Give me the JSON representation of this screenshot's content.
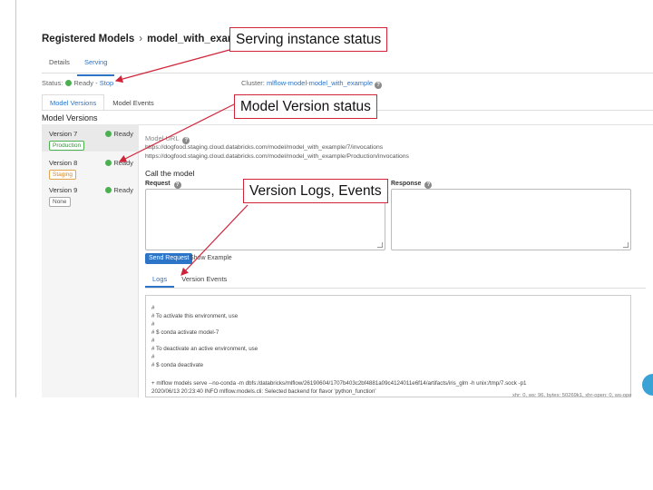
{
  "breadcrumb": {
    "parent": "Registered Models",
    "separator": "›",
    "model": "model_with_example",
    "caret": "▾"
  },
  "top_tabs": [
    {
      "label": "Details"
    },
    {
      "label": "Serving",
      "active": true
    }
  ],
  "status": {
    "label": "Status:",
    "state": "Ready",
    "separator": "-",
    "action": "Stop"
  },
  "cluster": {
    "label": "Cluster:",
    "name": "mlflow-model-model_with_example"
  },
  "model_tabs": [
    {
      "label": "Model Versions",
      "active": true
    },
    {
      "label": "Model Events"
    }
  ],
  "section_title": "Model Versions",
  "versions": [
    {
      "name": "Version 7",
      "status": "Ready",
      "stage": "Production",
      "selected": true
    },
    {
      "name": "Version 8",
      "status": "Ready",
      "stage": "Staging"
    },
    {
      "name": "Version 9",
      "status": "Ready",
      "stage": "None"
    }
  ],
  "detail": {
    "uri_label": "Model URL",
    "uris": [
      "https://dogfood.staging.cloud.databricks.com/model/model_with_example/7/invocations",
      "https://dogfood.staging.cloud.databricks.com/model/model_with_example/Production/invocations"
    ],
    "call_title": "Call the model",
    "request_label": "Request",
    "response_label": "Response",
    "send_button": "Send Request",
    "show_example": "Show Example"
  },
  "log_tabs": [
    {
      "label": "Logs",
      "active": true
    },
    {
      "label": "Version Events"
    }
  ],
  "log_lines": [
    "#",
    "# To activate this environment, use",
    "#",
    "#     $ conda activate model-7",
    "#",
    "# To deactivate an active environment, use",
    "#",
    "#     $ conda deactivate",
    "",
    "+ mlflow models serve --no-conda -m dbfs:/databricks/mlflow/26190604/1707b403c2bf4881a09c4124011e6f14/artifacts/iris_glm -h unix:/tmp/7.sock -p1",
    "2020/06/13 20:23:40 INFO mlflow.models.cli: Selected backend for flavor 'python_function'"
  ],
  "debug_text": "xhr: 0, ws: 96, bytes: 50269k1, xhr-open: 0, ws-ope",
  "annotations": {
    "serving_status": "Serving instance status",
    "version_status": "Model Version status",
    "version_logs": "Version Logs, Events"
  },
  "colors": {
    "accent": "#2b74c7",
    "ready": "#4caf50",
    "callout_border": "#d0243a",
    "production": "#4caf50",
    "staging": "#e3a54b"
  }
}
